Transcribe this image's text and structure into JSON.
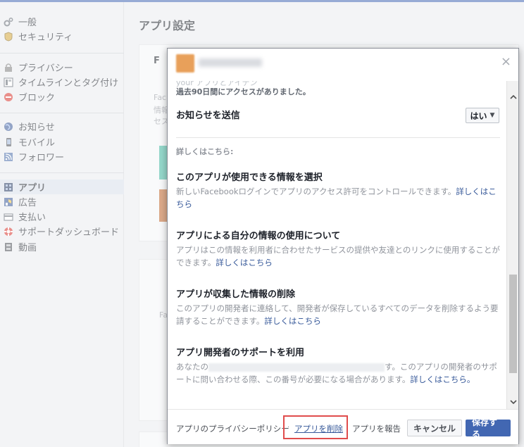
{
  "sidebar": {
    "items": [
      {
        "label": "一般",
        "icon": "gear-icon"
      },
      {
        "label": "セキュリティ",
        "icon": "badge-icon"
      },
      {
        "label": "プライバシー",
        "icon": "lock-icon"
      },
      {
        "label": "タイムラインとタグ付け",
        "icon": "timeline-icon"
      },
      {
        "label": "ブロック",
        "icon": "block-icon"
      },
      {
        "label": "お知らせ",
        "icon": "globe-icon"
      },
      {
        "label": "モバイル",
        "icon": "mobile-icon"
      },
      {
        "label": "フォロワー",
        "icon": "rss-icon"
      },
      {
        "label": "アプリ",
        "icon": "apps-icon"
      },
      {
        "label": "広告",
        "icon": "ads-icon"
      },
      {
        "label": "支払い",
        "icon": "card-icon"
      },
      {
        "label": "サポートダッシュボード",
        "icon": "lifebuoy-icon"
      },
      {
        "label": "動画",
        "icon": "film-icon"
      }
    ]
  },
  "main": {
    "title": "アプリ設定",
    "card_heading": "F",
    "card_lines": [
      "Fac",
      "情報",
      "セス"
    ],
    "card2_text": "Fa"
  },
  "dialog": {
    "faded_text": "your アプリとアイテン",
    "last_access": "過去90日間にアクセスがありました。",
    "notify_label": "お知らせを送信",
    "notify_value": "はい",
    "learn_more": "詳しくはこちら:",
    "sections": [
      {
        "title": "このアプリが使用できる情報を選択",
        "desc": "新しいFacebookログインでアプリのアクセス許可をコントロールできます。",
        "link": "詳しくはこちら"
      },
      {
        "title": "アプリによる自分の情報の使用について",
        "desc": "アプリはこの情報を利用者に合わせたサービスの提供や友達とのリンクに使用することができます。",
        "link": "詳しくはこちら"
      },
      {
        "title": "アプリが収集した情報の削除",
        "desc": "このアプリの開発者に連絡して、開発者が保存しているすべてのデータを削除するよう要請することができます。",
        "link": "詳しくはこちら"
      },
      {
        "title": "アプリ開発者のサポートを利用",
        "desc_before": "あなたの",
        "desc_after": "す。このアプリの開発者のサポートに問い合わせる際、この番号が必要になる場合があります。",
        "link": "詳しくはこちら。"
      }
    ],
    "footer": {
      "privacy_policy": "アプリのプライバシーポリシー",
      "remove_app": "アプリを削除",
      "report_app": "アプリを報告",
      "cancel": "キャンセル",
      "save": "保存する"
    }
  },
  "colors": {
    "accent": "#4267b2",
    "link": "#365899",
    "highlight_box": "#e04c4c",
    "active_nav": "#d8dfea"
  }
}
